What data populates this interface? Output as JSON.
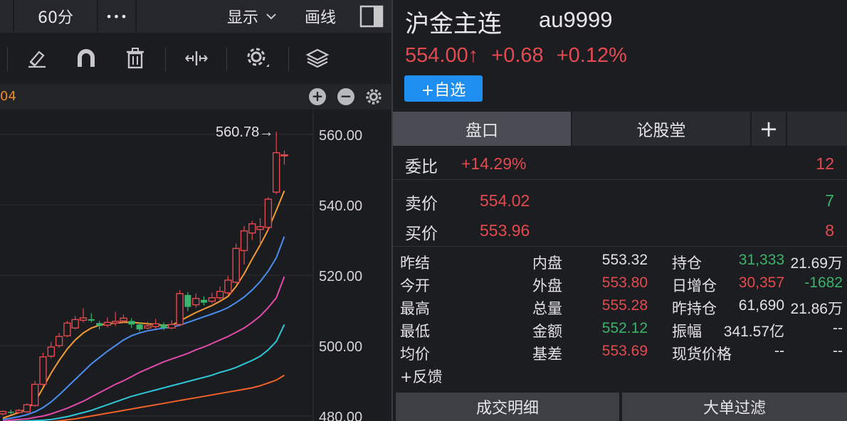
{
  "topbar": {
    "period": "60分",
    "more": "•••",
    "display": "显示",
    "draw": "画线"
  },
  "toolbar": {
    "tools": [
      "eraser-icon",
      "magnet-icon",
      "trash-icon",
      "split-icon",
      "gear-icon",
      "layers-icon"
    ]
  },
  "subbar": {
    "ma_label": "04",
    "zoom_in": "+",
    "zoom_out": "−"
  },
  "chart_data": {
    "type": "candlestick",
    "y_ticks": [
      "560.00",
      "540.00",
      "520.00",
      "500.00",
      "480.00"
    ],
    "ylim": [
      480,
      560
    ],
    "high_label": "560.78→",
    "candles": [
      {
        "o": 480.6,
        "c": 481.3,
        "h": 481.6,
        "l": 480.2
      },
      {
        "o": 481.2,
        "c": 480.9,
        "h": 481.8,
        "l": 480.5
      },
      {
        "o": 481.0,
        "c": 481.6,
        "h": 482.0,
        "l": 480.7
      },
      {
        "o": 481.2,
        "c": 483.2,
        "h": 483.6,
        "l": 480.9
      },
      {
        "o": 483.0,
        "c": 489.0,
        "h": 490.0,
        "l": 482.6
      },
      {
        "o": 489.0,
        "c": 496.8,
        "h": 498.0,
        "l": 488.6
      },
      {
        "o": 497.0,
        "c": 499.6,
        "h": 501.0,
        "l": 496.4
      },
      {
        "o": 500.0,
        "c": 502.6,
        "h": 503.6,
        "l": 499.4
      },
      {
        "o": 502.8,
        "c": 506.4,
        "h": 507.0,
        "l": 502.4
      },
      {
        "o": 505.0,
        "c": 507.4,
        "h": 508.4,
        "l": 504.6
      },
      {
        "o": 507.2,
        "c": 507.9,
        "h": 510.6,
        "l": 506.6
      },
      {
        "o": 507.5,
        "c": 507.1,
        "h": 509.2,
        "l": 506.6
      },
      {
        "o": 506.4,
        "c": 505.6,
        "h": 507.0,
        "l": 504.6
      },
      {
        "o": 505.8,
        "c": 506.6,
        "h": 508.0,
        "l": 505.2
      },
      {
        "o": 506.4,
        "c": 506.9,
        "h": 509.6,
        "l": 505.6
      },
      {
        "o": 507.0,
        "c": 507.8,
        "h": 508.8,
        "l": 506.4
      },
      {
        "o": 507.0,
        "c": 506.0,
        "h": 507.8,
        "l": 505.0
      },
      {
        "o": 506.0,
        "c": 504.6,
        "h": 506.6,
        "l": 504.0
      },
      {
        "o": 505.0,
        "c": 505.6,
        "h": 506.8,
        "l": 504.6
      },
      {
        "o": 505.4,
        "c": 506.2,
        "h": 507.6,
        "l": 504.8
      },
      {
        "o": 506.0,
        "c": 505.0,
        "h": 506.6,
        "l": 504.4
      },
      {
        "o": 505.0,
        "c": 506.0,
        "h": 507.2,
        "l": 504.6
      },
      {
        "o": 506.0,
        "c": 514.8,
        "h": 515.8,
        "l": 505.6
      },
      {
        "o": 514.4,
        "c": 511.0,
        "h": 515.2,
        "l": 509.8
      },
      {
        "o": 511.6,
        "c": 513.4,
        "h": 514.8,
        "l": 510.8
      },
      {
        "o": 513.0,
        "c": 512.2,
        "h": 514.0,
        "l": 511.4
      },
      {
        "o": 512.6,
        "c": 513.6,
        "h": 515.0,
        "l": 512.0
      },
      {
        "o": 513.6,
        "c": 515.4,
        "h": 516.8,
        "l": 513.0
      },
      {
        "o": 515.0,
        "c": 518.6,
        "h": 519.8,
        "l": 514.4
      },
      {
        "o": 518.0,
        "c": 527.6,
        "h": 529.0,
        "l": 517.6
      },
      {
        "o": 527.0,
        "c": 532.6,
        "h": 534.0,
        "l": 523.0
      },
      {
        "o": 532.0,
        "c": 534.6,
        "h": 535.4,
        "l": 530.0
      },
      {
        "o": 533.0,
        "c": 533.8,
        "h": 536.2,
        "l": 528.6
      },
      {
        "o": 533.6,
        "c": 541.6,
        "h": 542.2,
        "l": 532.6
      },
      {
        "o": 543.6,
        "c": 554.8,
        "h": 560.78,
        "l": 543.0
      },
      {
        "o": 554.0,
        "c": 554.2,
        "h": 555.4,
        "l": 551.4
      }
    ],
    "ma_series": [
      {
        "color": "#f39c36",
        "values": [
          479.4,
          480.2,
          481.0,
          482.0,
          484.0,
          488.0,
          492.2,
          495.8,
          499.0,
          501.6,
          503.6,
          505.0,
          505.8,
          506.2,
          506.4,
          506.6,
          506.6,
          506.4,
          506.2,
          506.0,
          505.8,
          505.8,
          507.0,
          508.2,
          509.4,
          510.4,
          511.4,
          512.6,
          514.0,
          516.8,
          520.4,
          524.6,
          528.6,
          533.0,
          538.4,
          544.0
        ]
      },
      {
        "color": "#4a8ef0",
        "values": [
          479.0,
          479.4,
          479.8,
          480.4,
          481.2,
          482.4,
          484.0,
          486.0,
          488.2,
          490.4,
          492.6,
          494.8,
          496.6,
          498.4,
          500.0,
          501.6,
          502.8,
          503.6,
          504.2,
          504.6,
          505.0,
          505.2,
          505.8,
          506.6,
          507.4,
          508.2,
          509.0,
          509.8,
          510.8,
          512.2,
          513.8,
          515.8,
          518.2,
          521.2,
          525.0,
          531.0
        ]
      },
      {
        "color": "#e04aa8",
        "values": [
          478.6,
          478.8,
          479.0,
          479.2,
          479.6,
          480.0,
          480.6,
          481.4,
          482.2,
          483.2,
          484.2,
          485.4,
          486.6,
          487.8,
          489.0,
          490.0,
          491.2,
          492.4,
          493.4,
          494.4,
          495.4,
          496.2,
          497.0,
          497.8,
          498.8,
          499.6,
          500.6,
          501.6,
          502.6,
          503.8,
          505.0,
          506.6,
          508.4,
          510.8,
          513.6,
          519.6
        ]
      },
      {
        "color": "#2ec7d8",
        "values": [
          478.2,
          478.4,
          478.5,
          478.6,
          478.7,
          478.8,
          479.0,
          479.4,
          479.8,
          480.4,
          481.0,
          481.6,
          482.4,
          483.2,
          484.0,
          484.8,
          485.6,
          486.2,
          486.8,
          487.4,
          488.0,
          488.6,
          489.2,
          489.8,
          490.4,
          491.0,
          491.6,
          492.4,
          493.0,
          493.8,
          494.8,
          495.8,
          497.0,
          498.8,
          501.2,
          506.0
        ]
      },
      {
        "color": "#f0622a",
        "values": [
          477.2,
          477.4,
          477.6,
          477.8,
          478.0,
          478.2,
          478.4,
          478.6,
          478.9,
          479.2,
          479.6,
          480.0,
          480.4,
          480.8,
          481.2,
          481.6,
          482.0,
          482.4,
          482.8,
          483.2,
          483.6,
          484.0,
          484.4,
          484.8,
          485.2,
          485.6,
          486.0,
          486.4,
          486.8,
          487.2,
          487.6,
          488.0,
          488.6,
          489.4,
          490.2,
          491.6
        ]
      }
    ]
  },
  "header": {
    "name": "沪金主连",
    "code": "au9999",
    "price": "554.00↑",
    "change": "+0.68",
    "change_pct": "+0.12%",
    "add_watch": "+自选"
  },
  "tabs": {
    "quote": "盘口",
    "forum": "论股堂",
    "plus": "+"
  },
  "orderbook": {
    "ratio_label": "委比",
    "ratio_value": "+14.29%",
    "ratio_diff": "12",
    "ask_label": "卖价",
    "ask_price": "554.02",
    "ask_vol": "7",
    "bid_label": "买价",
    "bid_price": "553.96",
    "bid_vol": "8"
  },
  "stats": {
    "col1": [
      {
        "label": "昨结",
        "value": "553.32",
        "color": "white"
      },
      {
        "label": "今开",
        "value": "553.80",
        "color": "red"
      },
      {
        "label": "最高",
        "value": "555.28",
        "color": "red"
      },
      {
        "label": "最低",
        "value": "552.12",
        "color": "green"
      },
      {
        "label": "均价",
        "value": "553.69",
        "color": "red"
      }
    ],
    "col2": [
      {
        "label": "内盘",
        "value": "31,333",
        "color": "green"
      },
      {
        "label": "外盘",
        "value": "30,357",
        "color": "red"
      },
      {
        "label": "总量",
        "value": "61,690",
        "color": "white"
      },
      {
        "label": "金额",
        "value": "341.57亿",
        "color": "white"
      },
      {
        "label": "基差",
        "value": "--",
        "color": "white"
      }
    ],
    "col3": [
      {
        "label": "持仓",
        "value": "21.69万",
        "color": "white"
      },
      {
        "label": "日增仓",
        "value": "-1682",
        "color": "green"
      },
      {
        "label": "昨持仓",
        "value": "21.86万",
        "color": "white"
      },
      {
        "label": "振幅",
        "value": "--",
        "color": "white"
      },
      {
        "label": "现货价格",
        "value": "--",
        "color": "white"
      }
    ]
  },
  "feedback": "+反馈",
  "bottom_tabs": {
    "trades": "成交明细",
    "big_filter": "大单过滤"
  },
  "colors": {
    "up": "#e34a4f",
    "down": "#3ab36c",
    "accent": "#1e8ef0"
  }
}
